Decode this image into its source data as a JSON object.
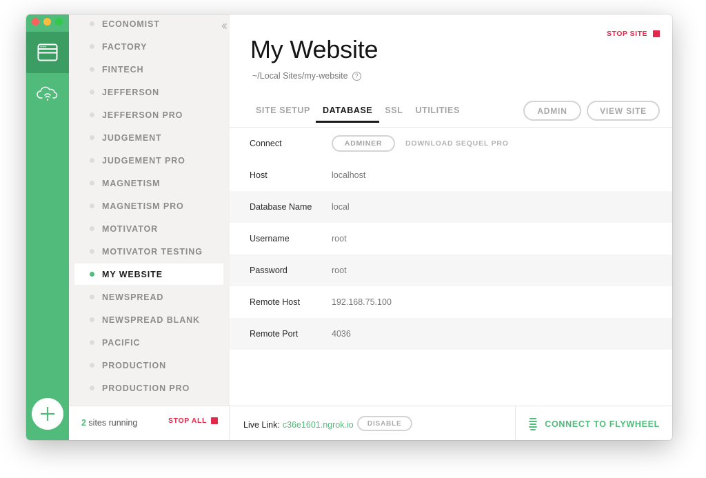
{
  "sidebar": {
    "sites": [
      {
        "name": "ECONOMIST",
        "active": false
      },
      {
        "name": "FACTORY",
        "active": false
      },
      {
        "name": "FINTECH",
        "active": false
      },
      {
        "name": "JEFFERSON",
        "active": false
      },
      {
        "name": "JEFFERSON PRO",
        "active": false
      },
      {
        "name": "JUDGEMENT",
        "active": false
      },
      {
        "name": "JUDGEMENT PRO",
        "active": false
      },
      {
        "name": "MAGNETISM",
        "active": false
      },
      {
        "name": "MAGNETISM PRO",
        "active": false
      },
      {
        "name": "MOTIVATOR",
        "active": false
      },
      {
        "name": "MOTIVATOR TESTING",
        "active": false
      },
      {
        "name": "MY WEBSITE",
        "active": true
      },
      {
        "name": "NEWSPREAD",
        "active": false
      },
      {
        "name": "NEWSPREAD BLANK",
        "active": false
      },
      {
        "name": "PACIFIC",
        "active": false
      },
      {
        "name": "PRODUCTION",
        "active": false
      },
      {
        "name": "PRODUCTION PRO",
        "active": false
      }
    ],
    "footer": {
      "running_count": "2",
      "running_text": " sites running",
      "stop_all_label": "STOP ALL"
    }
  },
  "header": {
    "stop_site_label": "STOP SITE",
    "title": "My Website",
    "path": "~/Local Sites/my-website",
    "path_info": "?"
  },
  "tabs": [
    {
      "label": "SITE SETUP",
      "active": false
    },
    {
      "label": "DATABASE",
      "active": true
    },
    {
      "label": "SSL",
      "active": false
    },
    {
      "label": "UTILITIES",
      "active": false
    }
  ],
  "tab_buttons": {
    "admin": "ADMIN",
    "view_site": "VIEW SITE"
  },
  "database": {
    "connect_label": "Connect",
    "adminer_label": "ADMINER",
    "download_sequel_label": "DOWNLOAD SEQUEL PRO",
    "rows": [
      {
        "label": "Host",
        "value": "localhost"
      },
      {
        "label": "Database Name",
        "value": "local"
      },
      {
        "label": "Username",
        "value": "root"
      },
      {
        "label": "Password",
        "value": "root"
      },
      {
        "label": "Remote Host",
        "value": "192.168.75.100"
      },
      {
        "label": "Remote Port",
        "value": "4036"
      }
    ]
  },
  "bottom_bar": {
    "live_link_label": "Live Link:",
    "live_link_url": "c36e1601.ngrok.io",
    "disable_label": "DISABLE",
    "flywheel_label": "CONNECT TO FLYWHEEL"
  },
  "colors": {
    "brand_green": "#51bb7b",
    "brand_green_dark": "#3c9d63",
    "stop_red": "#e3294b"
  },
  "icons": {
    "rail_sites": "browser-window-icon",
    "rail_cloud": "cloud-sync-icon",
    "rail_add": "plus-icon",
    "collapse": "double-chevron-left-icon",
    "flywheel": "flywheel-icon"
  }
}
